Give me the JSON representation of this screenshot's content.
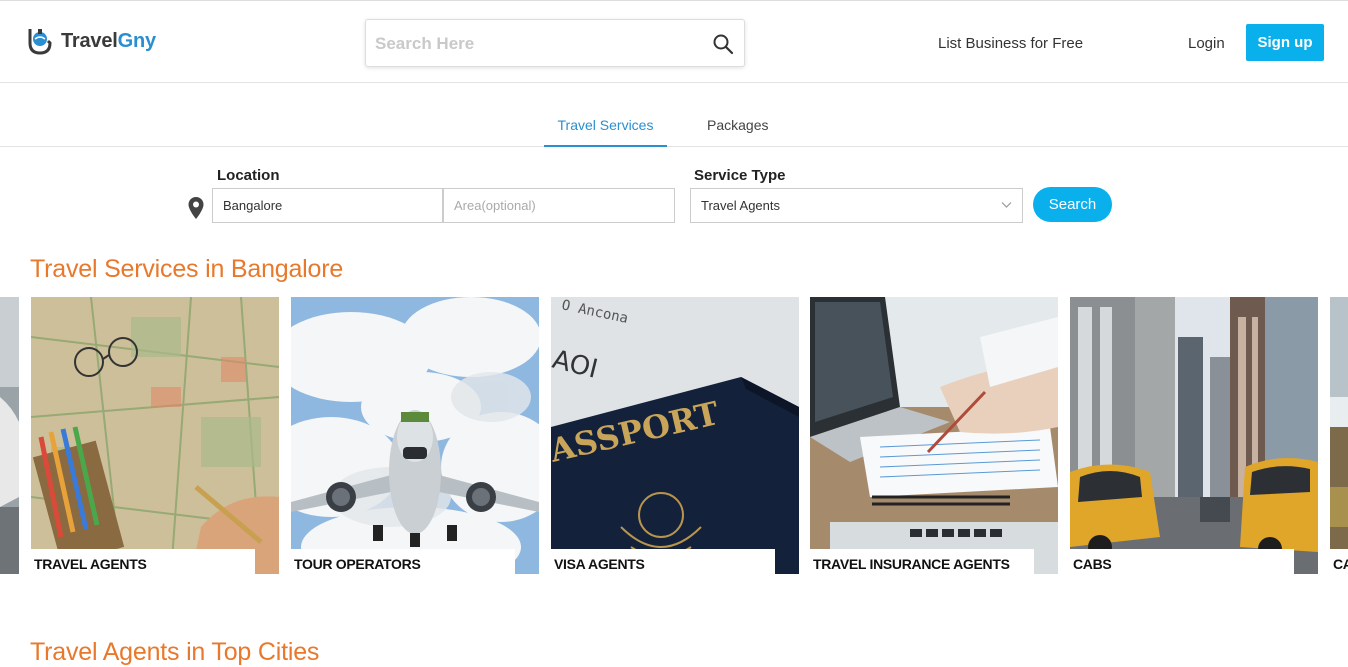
{
  "header": {
    "logo": {
      "part1": "Travel",
      "part2": "Gny"
    },
    "search_placeholder": "Search Here",
    "list_business": "List Business for Free",
    "login": "Login",
    "signup": "Sign up"
  },
  "tabs": [
    {
      "label": "Travel Services",
      "active": true
    },
    {
      "label": "Packages",
      "active": false
    }
  ],
  "form": {
    "location_label": "Location",
    "location_value": "Bangalore",
    "area_placeholder": "Area(optional)",
    "service_label": "Service Type",
    "service_value": "Travel Agents",
    "search_button": "Search"
  },
  "sections": {
    "services_title": "Travel Services in Bangalore",
    "top_cities_title": "Travel Agents in Top Cities"
  },
  "cards": [
    {
      "label": "TRAVEL AGENTS",
      "icon": "map-photo"
    },
    {
      "label": "TOUR OPERATORS",
      "icon": "airplane-photo"
    },
    {
      "label": "VISA AGENTS",
      "icon": "passport-photo"
    },
    {
      "label": "TRAVEL INSURANCE AGENTS",
      "icon": "laptop-photo"
    },
    {
      "label": "CABS",
      "icon": "city-taxi-photo"
    },
    {
      "label": "CA",
      "icon": "partial-card"
    }
  ],
  "colors": {
    "accent": "#0ab0ec",
    "link": "#2a8fd0",
    "title": "#e8792c"
  }
}
